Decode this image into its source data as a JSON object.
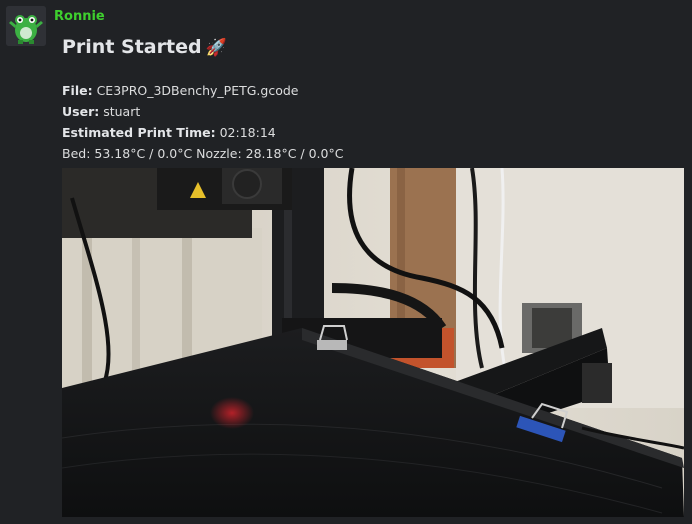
{
  "author": {
    "name": "Ronnie",
    "avatar_icon": "green-robot-avatar-icon",
    "name_color": "#3ecf2e"
  },
  "embed": {
    "title": "Print Started",
    "title_icon": "rocket-emoji",
    "title_emoji": "🚀",
    "fields": [
      {
        "label": "File:",
        "value": "CE3PRO_3DBenchy_PETG.gcode"
      },
      {
        "label": "User:",
        "value": "stuart"
      },
      {
        "label": "Estimated Print Time:",
        "value": "02:18:14"
      }
    ],
    "temps": {
      "bed_label": "Bed:",
      "bed_value": "53.18°C / 0.0°C",
      "nozzle_label": "Nozzle:",
      "nozzle_value": "28.18°C / 0.0°C"
    },
    "image": "3d-printer-webcam-snapshot"
  },
  "colors": {
    "background": "#202225",
    "text": "#dcddde",
    "title": "#e3e5e8"
  }
}
